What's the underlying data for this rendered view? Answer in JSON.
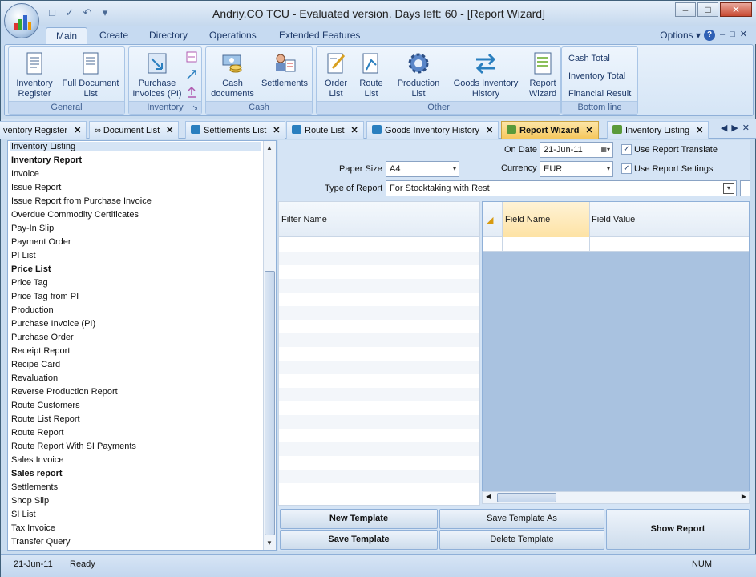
{
  "window": {
    "title": "Andriy.CO TCU - Evaluated version. Days left: 60 - [Report Wizard]"
  },
  "ribbon_tabs": [
    "Main",
    "Create",
    "Directory",
    "Operations",
    "Extended Features"
  ],
  "options_label": "Options",
  "groups": {
    "general": {
      "label": "General",
      "buttons": [
        {
          "line1": "Inventory",
          "line2": "Register"
        },
        {
          "line1": "Full Document",
          "line2": "List"
        }
      ]
    },
    "inventory": {
      "label": "Inventory",
      "buttons": [
        {
          "line1": "Purchase",
          "line2": "Invoices (PI)"
        }
      ]
    },
    "cash": {
      "label": "Cash",
      "buttons": [
        {
          "line1": "Cash",
          "line2": "documents"
        },
        {
          "line1": "Settlements",
          "line2": ""
        }
      ]
    },
    "other": {
      "label": "Other",
      "buttons": [
        {
          "line1": "Order",
          "line2": "List"
        },
        {
          "line1": "Route",
          "line2": "List"
        },
        {
          "line1": "Production",
          "line2": "List"
        },
        {
          "line1": "Goods Inventory",
          "line2": "History"
        },
        {
          "line1": "Report",
          "line2": "Wizard"
        }
      ]
    },
    "bottom_line": {
      "label": "Bottom line",
      "links": [
        "Cash Total",
        "Inventory Total",
        "Financial Result"
      ]
    }
  },
  "doc_tabs": [
    {
      "label": "ventory Register",
      "active": false
    },
    {
      "label": "Document List",
      "active": false
    },
    {
      "label": "Settlements List",
      "active": false
    },
    {
      "label": "Route List",
      "active": false
    },
    {
      "label": "Goods Inventory History",
      "active": false
    },
    {
      "label": "Report Wizard",
      "active": true
    },
    {
      "label": "Inventory Listing",
      "active": false
    }
  ],
  "report_list": [
    {
      "label": "Inventory Listing",
      "bold": false,
      "selected": true
    },
    {
      "label": "Inventory Report",
      "bold": true
    },
    {
      "label": "Invoice",
      "bold": false
    },
    {
      "label": "Issue Report",
      "bold": false
    },
    {
      "label": "Issue Report from Purchase Invoice",
      "bold": false
    },
    {
      "label": "Overdue Commodity Certificates",
      "bold": false
    },
    {
      "label": "Pay-In Slip",
      "bold": false
    },
    {
      "label": "Payment Order",
      "bold": false
    },
    {
      "label": "PI List",
      "bold": false
    },
    {
      "label": "Price List",
      "bold": true
    },
    {
      "label": "Price Tag",
      "bold": false
    },
    {
      "label": "Price Tag from PI",
      "bold": false
    },
    {
      "label": "Production",
      "bold": false
    },
    {
      "label": "Purchase Invoice (PI)",
      "bold": false
    },
    {
      "label": "Purchase Order",
      "bold": false
    },
    {
      "label": "Receipt Report",
      "bold": false
    },
    {
      "label": "Recipe Card",
      "bold": false
    },
    {
      "label": "Revaluation",
      "bold": false
    },
    {
      "label": "Reverse Production Report",
      "bold": false
    },
    {
      "label": "Route Customers",
      "bold": false
    },
    {
      "label": "Route List Report",
      "bold": false
    },
    {
      "label": "Route Report",
      "bold": false
    },
    {
      "label": "Route Report With SI Payments",
      "bold": false
    },
    {
      "label": "Sales Invoice",
      "bold": false
    },
    {
      "label": "Sales report",
      "bold": true
    },
    {
      "label": "Settlements",
      "bold": false
    },
    {
      "label": "Shop Slip",
      "bold": false
    },
    {
      "label": "SI List",
      "bold": false
    },
    {
      "label": "Tax Invoice",
      "bold": false
    },
    {
      "label": "Transfer Query",
      "bold": false
    }
  ],
  "form": {
    "on_date_label": "On Date",
    "on_date_value": "21-Jun-11",
    "use_report_translate": "Use Report Translate",
    "paper_size_label": "Paper Size",
    "paper_size_value": "A4",
    "currency_label": "Currency",
    "currency_value": "EUR",
    "use_report_settings": "Use Report Settings",
    "type_label": "Type of Report",
    "type_value": "For Stocktaking with Rest"
  },
  "grids": {
    "filter_name": "Filter Name",
    "field_name": "Field Name",
    "field_value": "Field Value"
  },
  "buttons": {
    "new_template": "New Template",
    "save_template_as": "Save Template As",
    "save_template": "Save Template",
    "delete_template": "Delete Template",
    "show_report": "Show Report"
  },
  "status": {
    "date": "21-Jun-11",
    "state": "Ready",
    "num": "NUM"
  }
}
